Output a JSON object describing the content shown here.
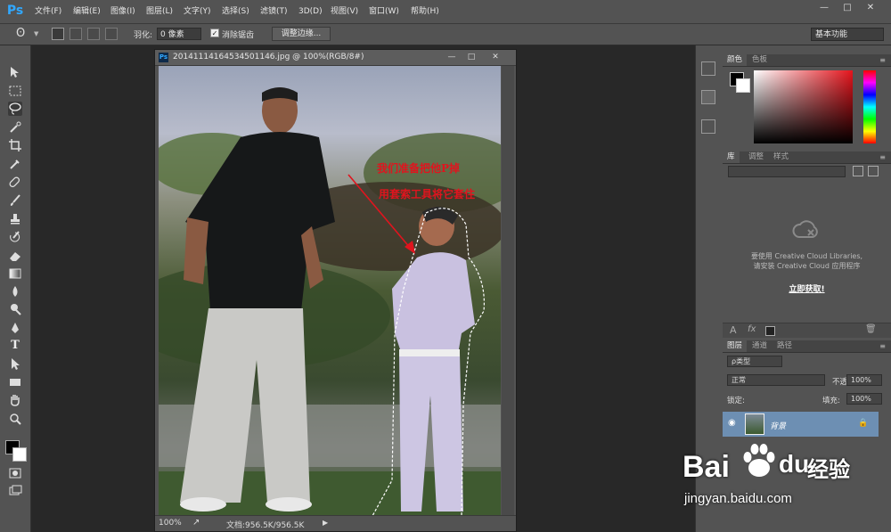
{
  "app": {
    "logo": "Ps"
  },
  "menu": [
    "文件(F)",
    "编辑(E)",
    "图像(I)",
    "图层(L)",
    "文字(Y)",
    "选择(S)",
    "滤镜(T)",
    "3D(D)",
    "视图(V)",
    "窗口(W)",
    "帮助(H)"
  ],
  "window_controls": {
    "minimize": "—",
    "maximize": "□",
    "close": "✕"
  },
  "options": {
    "feather_label": "羽化:",
    "feather_value": "0 像素",
    "antialias_label": "消除锯齿",
    "antialias_checked": "✓",
    "refine_button": "调整边缘...",
    "workspace": "基本功能"
  },
  "document": {
    "ps_badge": "Ps",
    "title": "20141114164534501146.jpg @ 100%(RGB/8#)",
    "annotation_line1": "我们准备把他P掉",
    "annotation_line2": "用套索工具将它套住",
    "zoom": "100%",
    "doc_info": "文档:956.5K/956.5K",
    "controls": {
      "minimize": "—",
      "maximize": "□",
      "close": "✕"
    }
  },
  "panels": {
    "color_tabs": [
      "颜色",
      "色板"
    ],
    "library_tabs": [
      "库",
      "调整",
      "样式"
    ],
    "library_message_1": "要使用 Creative Cloud Libraries,",
    "library_message_2": "请安装 Creative Cloud 应用程序",
    "library_cta": "立即获取!",
    "layers_tabs": [
      "图层",
      "通道",
      "路径"
    ],
    "filter_kind": "ρ类型",
    "blend_mode": "正常",
    "opacity_label": "不透明度:",
    "opacity_value": "100%",
    "lock_label": "锁定:",
    "fill_label": "填充:",
    "fill_value": "100%",
    "layer_name": "背景"
  },
  "watermark": {
    "brand": "Bai",
    "brand2": "du",
    "cn": "经验",
    "url": "jingyan.baidu.com"
  },
  "colors": {
    "accent": "#31a8ff",
    "annotation": "#e0141e",
    "layer_selected": "#6d8fb3"
  }
}
